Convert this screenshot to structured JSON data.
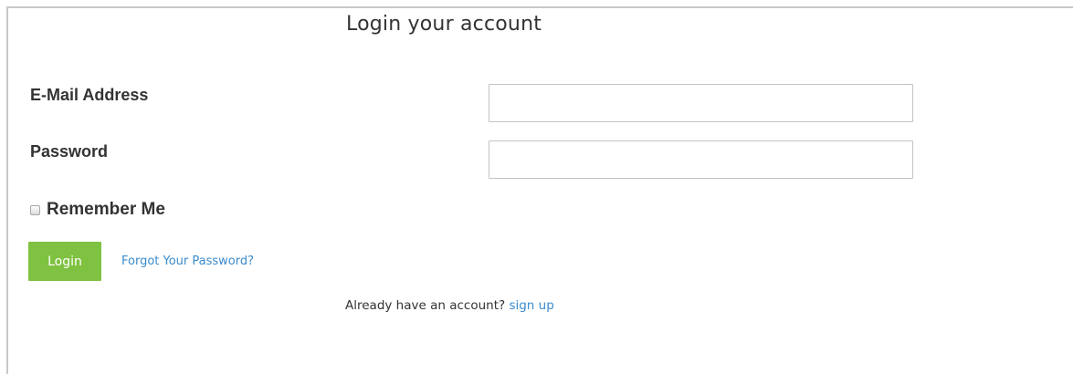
{
  "page": {
    "title": "Login your account"
  },
  "form": {
    "email": {
      "label": "E-Mail Address",
      "value": "",
      "placeholder": ""
    },
    "password": {
      "label": "Password",
      "value": "",
      "placeholder": ""
    },
    "remember": {
      "label": "Remember Me",
      "checked": false
    },
    "login_button_label": "Login",
    "forgot_link_label": "Forgot Your Password?"
  },
  "signup": {
    "prompt": "Already have an account?",
    "link_label": "sign up"
  },
  "colors": {
    "accent_green": "#7fc241",
    "link_blue": "#3a8bcd",
    "text": "#333333",
    "input_border": "#c4c4c4"
  }
}
